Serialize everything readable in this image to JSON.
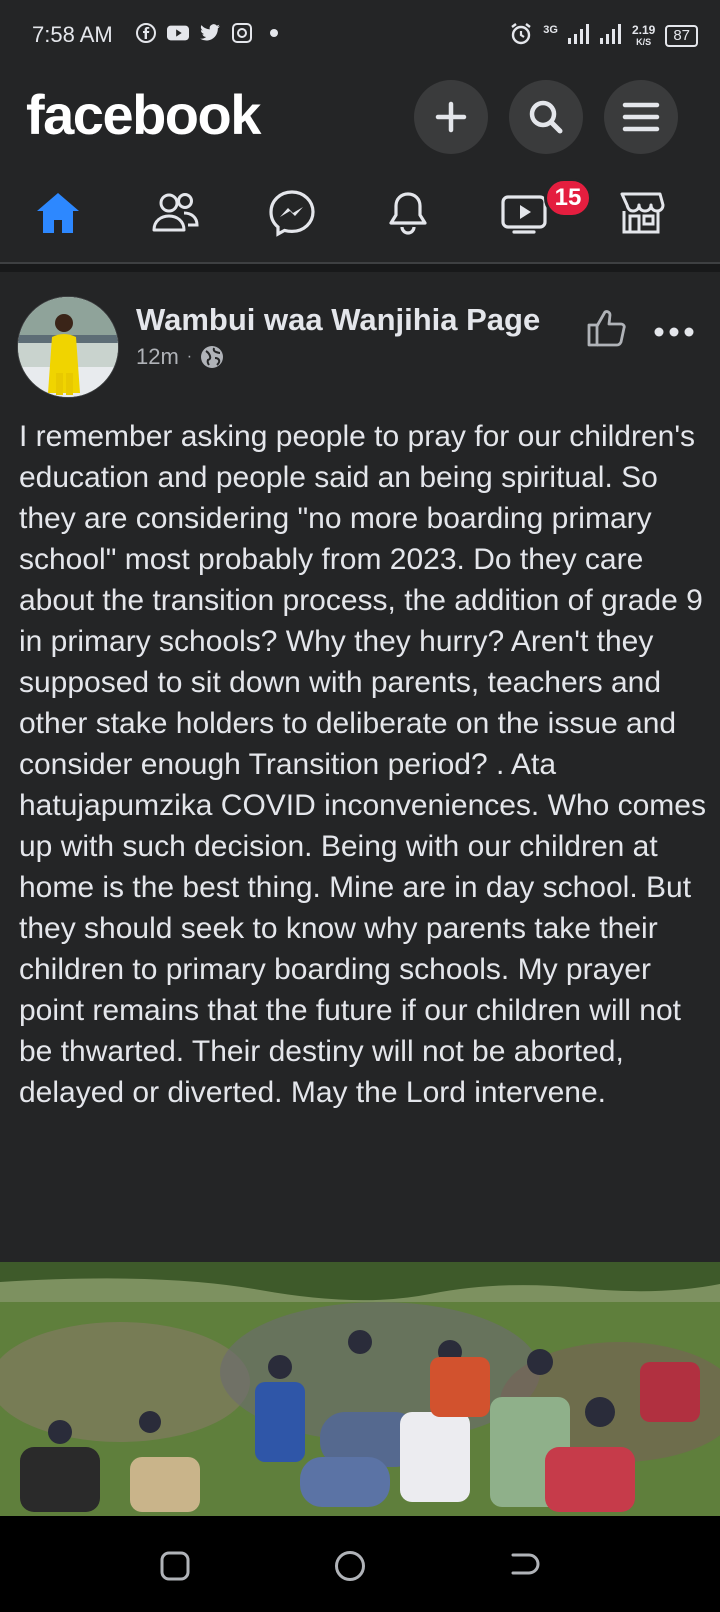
{
  "status_bar": {
    "time": "7:58 AM",
    "network": "3G",
    "speed_value": "2.19",
    "speed_unit": "K/S",
    "battery": "87"
  },
  "header": {
    "logo": "facebook"
  },
  "nav": {
    "video_badge": "15",
    "active_color": "#2d88ff"
  },
  "post": {
    "author": "Wambui waa Wanjihia Page",
    "time": "12m",
    "text": "I remember asking people to pray for our children's education and people said an being spiritual. So they are considering \"no more boarding primary school\" most probably from 2023. Do they care about the transition process, the addition of grade 9 in primary schools? Why they hurry? Aren't they supposed to sit down with parents, teachers and other stake holders to deliberate on the issue and consider enough Transition period? . Ata hatujapumzika COVID inconveniences. Who comes up with such decision. Being with our children at home is the best thing. Mine are in day school. But they should seek to know why parents take their children to primary boarding schools. My prayer point remains that the future if our children will not be thwarted. Their destiny will not be aborted, delayed or diverted. May the Lord intervene."
  }
}
